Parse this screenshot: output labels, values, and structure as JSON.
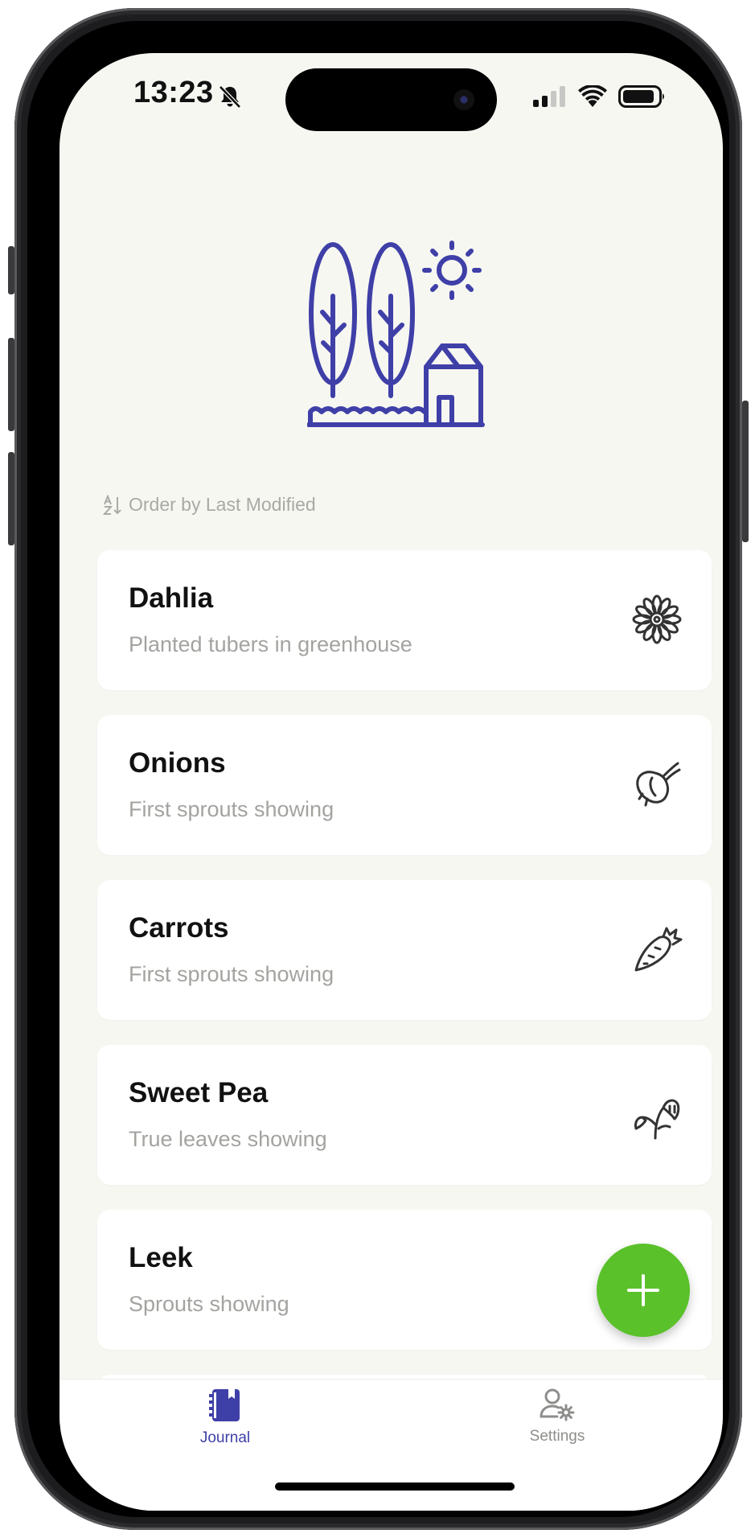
{
  "status_bar": {
    "time": "13:23"
  },
  "sort": {
    "label": "Order by Last Modified"
  },
  "entries": [
    {
      "title": "Dahlia",
      "subtitle": "Planted tubers in greenhouse",
      "icon": "flower-icon"
    },
    {
      "title": "Onions",
      "subtitle": "First sprouts showing",
      "icon": "onion-icon"
    },
    {
      "title": "Carrots",
      "subtitle": "First sprouts showing",
      "icon": "carrot-icon"
    },
    {
      "title": "Sweet Pea",
      "subtitle": "True leaves showing",
      "icon": "sweet-pea-icon"
    },
    {
      "title": "Leek",
      "subtitle": "Sprouts showing",
      "icon": ""
    }
  ],
  "fab": {
    "icon": "plus-icon"
  },
  "tabs": [
    {
      "label": "Journal",
      "icon": "journal-icon",
      "active": true
    },
    {
      "label": "Settings",
      "icon": "user-settings-icon",
      "active": false
    }
  ],
  "colors": {
    "accent": "#3f3fa8",
    "fab": "#5ac12a",
    "background": "#f7f7f2",
    "card": "#ffffff",
    "subtitle": "#a3a3a0",
    "inactive_tab": "#8e8e8c"
  }
}
